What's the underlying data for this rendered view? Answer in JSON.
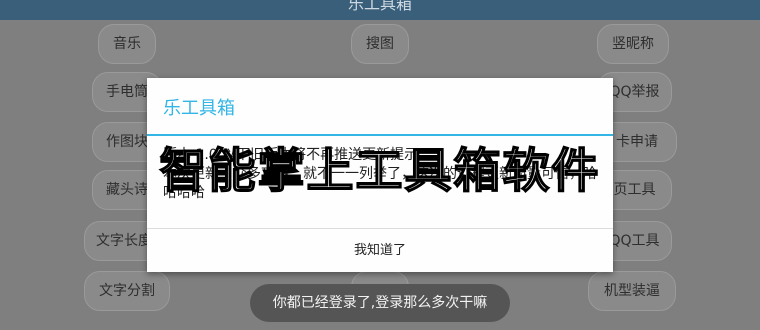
{
  "app": {
    "title": "乐工具箱"
  },
  "tiles": {
    "music": "音乐",
    "search_image": "搜图",
    "vertical_nickname": "竖昵称",
    "flashlight": "手电筒",
    "qq_report": "QQ举报",
    "make_image": "作图块",
    "card_apply": "卡申请",
    "hidden_poem": "藏头诗",
    "web_tools": "页工具",
    "text_long_image": "文字长度",
    "qq_tools": "QQ工具",
    "text_split": "文字分割",
    "model_fake": "机型装逼"
  },
  "dialog": {
    "title": "乐工具箱",
    "message": "版本 1.0  以下旧版本将不再推送更新提示。\n本次更新了众多功能，就不一一列举了，这次的远程更新质量可信，哈哈哈哈",
    "ok_label": "我知道了"
  },
  "overlay_text": "智能掌上工具箱软件",
  "toast": "你都已经登录了,登录那么多次干嘛"
}
